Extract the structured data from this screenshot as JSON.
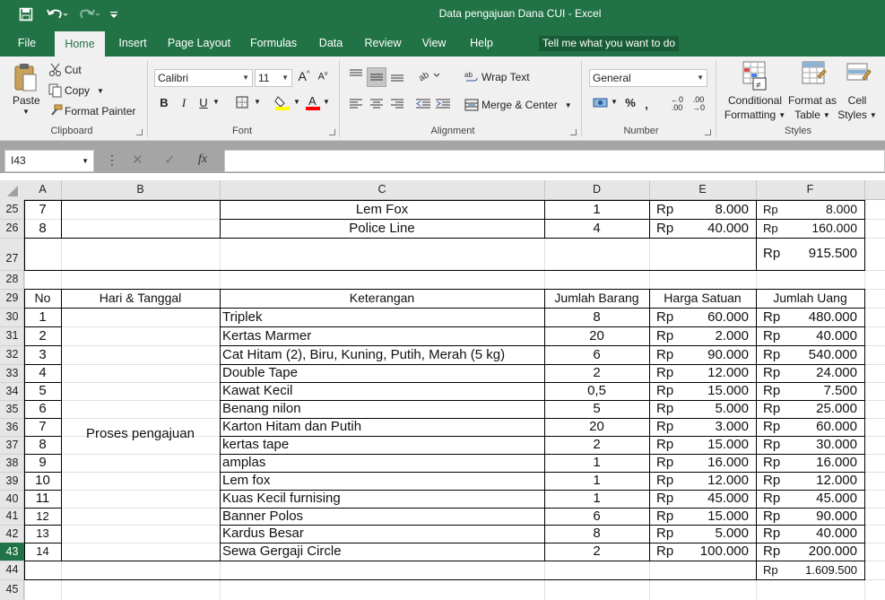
{
  "window": {
    "title": "Data pengajuan Dana CUI  -  Excel"
  },
  "tabs": [
    "File",
    "Home",
    "Insert",
    "Page Layout",
    "Formulas",
    "Data",
    "Review",
    "View",
    "Help"
  ],
  "tell_me": "Tell me what you want to do",
  "ribbon": {
    "clipboard": {
      "paste": "Paste",
      "cut": "Cut",
      "copy": "Copy",
      "format_painter": "Format Painter",
      "label": "Clipboard"
    },
    "font": {
      "name": "Calibri",
      "size": "11",
      "label": "Font"
    },
    "alignment": {
      "wrap": "Wrap Text",
      "merge": "Merge & Center",
      "label": "Alignment"
    },
    "number": {
      "format": "General",
      "label": "Number"
    },
    "styles": {
      "cond1": "Conditional",
      "cond2": "Formatting",
      "fmt1": "Format as",
      "fmt2": "Table",
      "cell1": "Cell",
      "cell2": "Styles",
      "label": "Styles"
    }
  },
  "name_box": "I43",
  "columns": [
    "A",
    "B",
    "C",
    "D",
    "E",
    "F"
  ],
  "rows": {
    "r25": {
      "num": "25",
      "a": "7",
      "c": "Lem Fox",
      "d": "1",
      "e_cur": "Rp",
      "e": "8.000",
      "f_cur": "Rp",
      "f": "8.000"
    },
    "r26": {
      "num": "26",
      "a": "8",
      "c": "Police Line",
      "d": "4",
      "e_cur": "Rp",
      "e": "40.000",
      "f_cur": "Rp",
      "f": "160.000"
    },
    "r27": {
      "num": "27",
      "f_cur": "Rp",
      "f": "915.500"
    },
    "r28": {
      "num": "28"
    }
  },
  "headers": {
    "num": "29",
    "a": "No",
    "b": "Hari & Tanggal",
    "c": "Keterangan",
    "d": "Jumlah Barang",
    "e": "Harga Satuan",
    "f": "Jumlah Uang"
  },
  "merged_b": "Proses pengajuan",
  "items": [
    {
      "num": "30",
      "no": "1",
      "ket": "Triplek",
      "jml": "8",
      "cur1": "Rp",
      "harga": "60.000",
      "cur2": "Rp",
      "total": "480.000"
    },
    {
      "num": "31",
      "no": "2",
      "ket": "Kertas Marmer",
      "jml": "20",
      "cur1": "Rp",
      "harga": "2.000",
      "cur2": "Rp",
      "total": "40.000"
    },
    {
      "num": "32",
      "no": "3",
      "ket": "Cat Hitam (2), Biru, Kuning, Putih, Merah (5 kg)",
      "jml": "6",
      "cur1": "Rp",
      "harga": "90.000",
      "cur2": "Rp",
      "total": "540.000"
    },
    {
      "num": "33",
      "no": "4",
      "ket": "Double Tape",
      "jml": "2",
      "cur1": "Rp",
      "harga": "12.000",
      "cur2": "Rp",
      "total": "24.000"
    },
    {
      "num": "34",
      "no": "5",
      "ket": "Kawat Kecil",
      "jml": "0,5",
      "cur1": "Rp",
      "harga": "15.000",
      "cur2": "Rp",
      "total": "7.500"
    },
    {
      "num": "35",
      "no": "6",
      "ket": "Benang nilon",
      "jml": "5",
      "cur1": "Rp",
      "harga": "5.000",
      "cur2": "Rp",
      "total": "25.000"
    },
    {
      "num": "36",
      "no": "7",
      "ket": "Karton Hitam dan Putih",
      "jml": "20",
      "cur1": "Rp",
      "harga": "3.000",
      "cur2": "Rp",
      "total": "60.000"
    },
    {
      "num": "37",
      "no": "8",
      "ket": "kertas tape",
      "jml": "2",
      "cur1": "Rp",
      "harga": "15.000",
      "cur2": "Rp",
      "total": "30.000"
    },
    {
      "num": "38",
      "no": "9",
      "ket": "amplas",
      "jml": "1",
      "cur1": "Rp",
      "harga": "16.000",
      "cur2": "Rp",
      "total": "16.000"
    },
    {
      "num": "39",
      "no": "10",
      "ket": "Lem fox",
      "jml": "1",
      "cur1": "Rp",
      "harga": "12.000",
      "cur2": "Rp",
      "total": "12.000"
    },
    {
      "num": "40",
      "no": "11",
      "ket": "Kuas Kecil furnising",
      "jml": "1",
      "cur1": "Rp",
      "harga": "45.000",
      "cur2": "Rp",
      "total": "45.000"
    },
    {
      "num": "41",
      "no": "12",
      "ket": "Banner Polos",
      "jml": "6",
      "cur1": "Rp",
      "harga": "15.000",
      "cur2": "Rp",
      "total": "90.000"
    },
    {
      "num": "42",
      "no": "13",
      "ket": "Kardus Besar",
      "jml": "8",
      "cur1": "Rp",
      "harga": "5.000",
      "cur2": "Rp",
      "total": "40.000"
    },
    {
      "num": "43",
      "no": "14",
      "ket": "Sewa Gergaji Circle",
      "jml": "2",
      "cur1": "Rp",
      "harga": "100.000",
      "cur2": "Rp",
      "total": "200.000"
    }
  ],
  "total_row": {
    "num": "44",
    "cur": "Rp",
    "value": "1.609.500"
  },
  "row45": {
    "num": "45"
  },
  "colors": {
    "excel_green": "#217346",
    "tell_me_bg": "#185c37",
    "ribbon_bg": "#f0f0f0",
    "header_bg": "#e6e6e6",
    "selected_header": "#217346"
  }
}
